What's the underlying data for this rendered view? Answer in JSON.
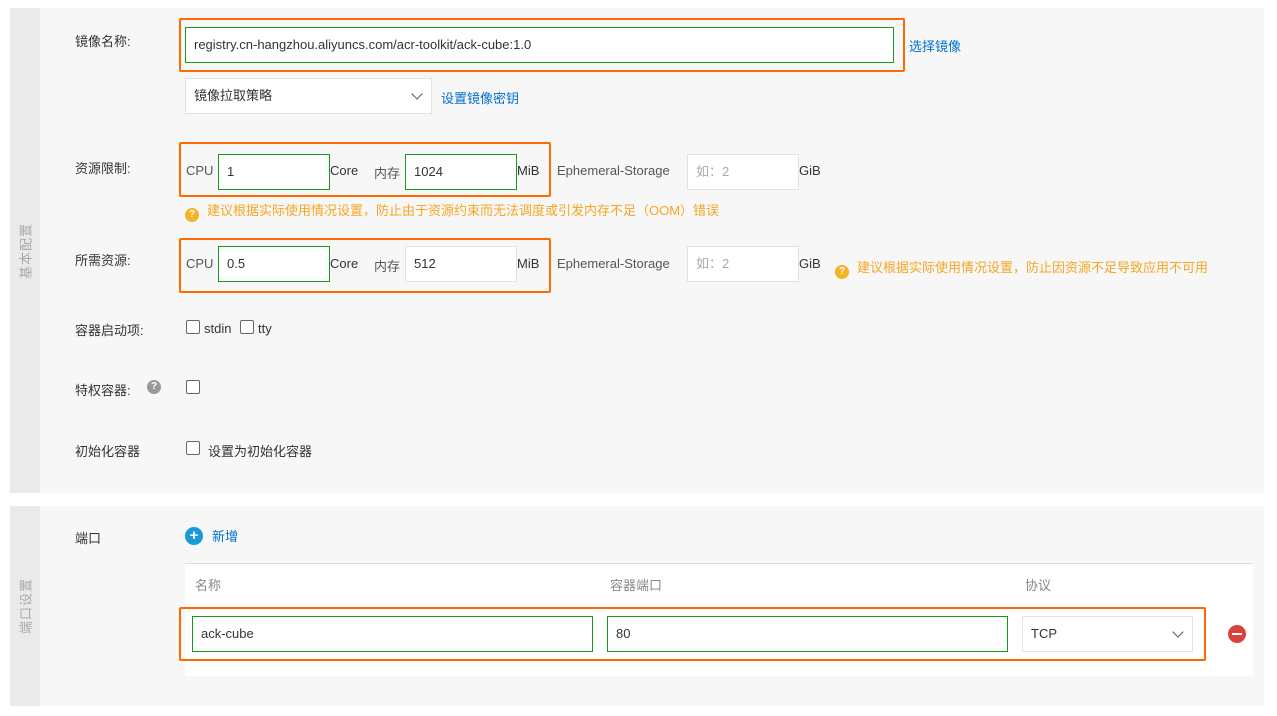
{
  "basic": {
    "section_label": "基本配置",
    "image_name": {
      "label": "镜像名称:",
      "value": "registry.cn-hangzhou.aliyuncs.com/acr-toolkit/ack-cube:1.0",
      "select_link": "选择镜像"
    },
    "pull_policy": {
      "value": "镜像拉取策略",
      "secret_link": "设置镜像密钥"
    },
    "limits": {
      "label": "资源限制:",
      "cpu_label": "CPU",
      "cpu_value": "1",
      "cpu_unit": "Core",
      "mem_label": "内存",
      "mem_value": "1024",
      "mem_unit": "MiB",
      "storage_label": "Ephemeral-Storage",
      "storage_placeholder": "如：2",
      "storage_unit": "GiB",
      "warning": "建议根据实际使用情况设置，防止由于资源约束而无法调度或引发内存不足（OOM）错误"
    },
    "requests": {
      "label": "所需资源:",
      "cpu_label": "CPU",
      "cpu_value": "0.5",
      "cpu_unit": "Core",
      "mem_label": "内存",
      "mem_value": "512",
      "mem_unit": "MiB",
      "storage_label": "Ephemeral-Storage",
      "storage_placeholder": "如：2",
      "storage_unit": "GiB",
      "warning": "建议根据实际使用情况设置，防止因资源不足导致应用不可用"
    },
    "startup": {
      "label": "容器启动项:",
      "stdin": "stdin",
      "tty": "tty"
    },
    "privileged": {
      "label": "特权容器:"
    },
    "init": {
      "label": "初始化容器",
      "checkbox_label": "设置为初始化容器"
    }
  },
  "ports": {
    "section_label": "端口设置",
    "label": "端口",
    "add_label": "新增",
    "columns": [
      "名称",
      "容器端口",
      "协议"
    ],
    "rows": [
      {
        "name": "ack-cube",
        "port": "80",
        "protocol": "TCP"
      }
    ]
  },
  "colors": {
    "highlight": "#ff6a00",
    "field_border": "#1a9a1a",
    "link": "#0070cc",
    "warning": "#f5a623"
  }
}
